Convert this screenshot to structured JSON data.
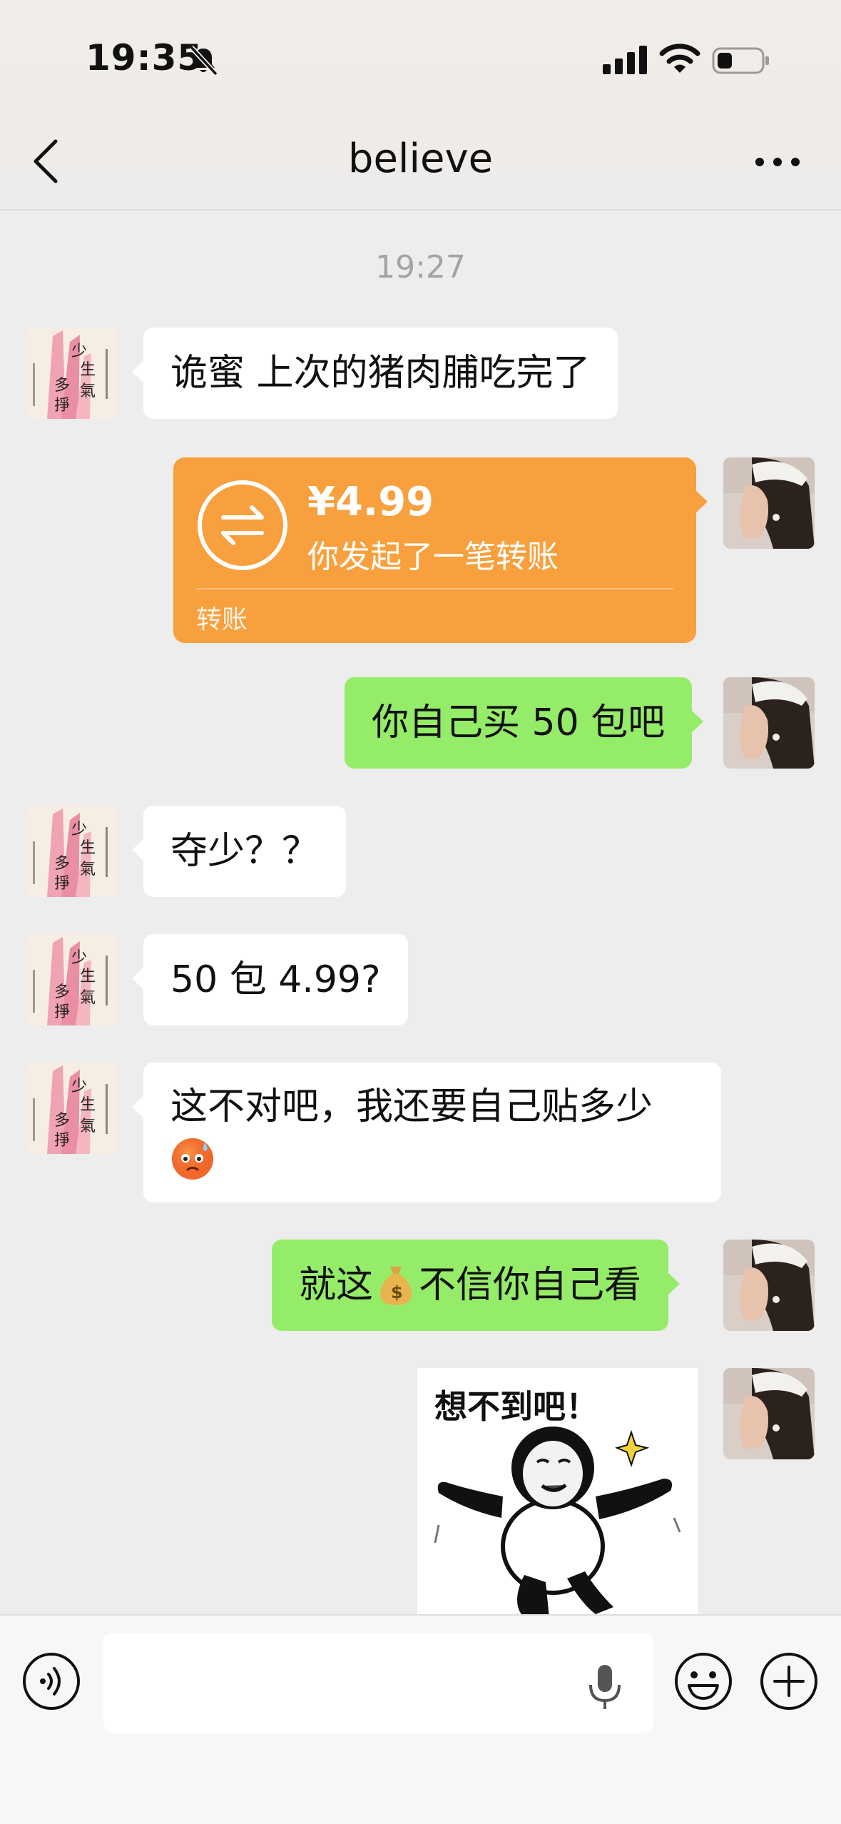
{
  "status_bar": {
    "time": "19:35"
  },
  "header": {
    "title": "believe"
  },
  "chat": {
    "timestamp": "19:27",
    "messages": [
      {
        "side": "left",
        "text": "诡蜜 上次的猪肉脯吃完了"
      },
      {
        "side": "right",
        "type": "transfer",
        "amount": "¥4.99",
        "description": "你发起了一笔转账",
        "label": "转账"
      },
      {
        "side": "right",
        "text": "你自己买 50 包吧"
      },
      {
        "side": "left",
        "text": "夺少？？"
      },
      {
        "side": "left",
        "text": "50 包 4.99?"
      },
      {
        "side": "left",
        "text": "这不对吧，我还要自己贴多少"
      },
      {
        "side": "right",
        "text_before": "就这",
        "text_after": "不信你自己看"
      },
      {
        "side": "right",
        "type": "sticker",
        "caption": "想不到吧！"
      }
    ]
  },
  "input_bar": {
    "value": "",
    "placeholder": ""
  },
  "colors": {
    "green_bubble": "#95ec69",
    "transfer_orange": "#f8a03e",
    "background": "#ededed"
  },
  "icons": [
    "back-arrow-icon",
    "more-dots-icon",
    "voice-icon",
    "microphone-icon",
    "emoji-icon",
    "plus-icon",
    "silent-bell-icon",
    "signal-icon",
    "wifi-icon",
    "battery-icon"
  ]
}
